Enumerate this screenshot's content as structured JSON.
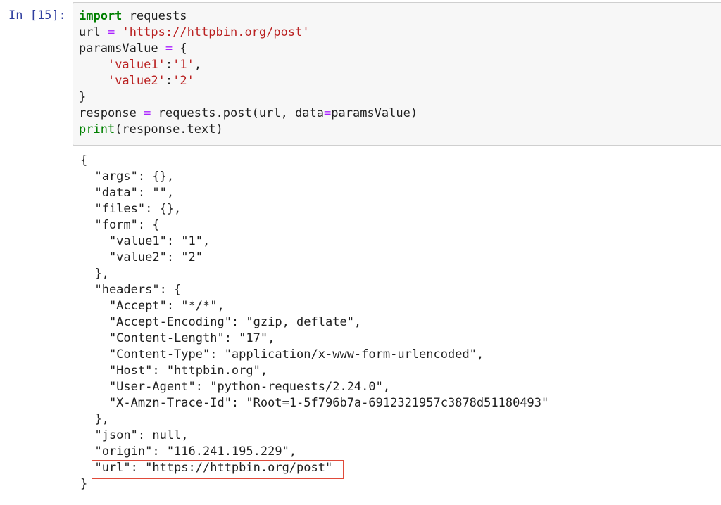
{
  "cell": {
    "prompt": "In [15]:",
    "code_lines": [
      [
        {
          "t": "import",
          "c": "kw"
        },
        {
          "t": " requests",
          "c": ""
        }
      ],
      [
        {
          "t": "url ",
          "c": ""
        },
        {
          "t": "=",
          "c": "op"
        },
        {
          "t": " ",
          "c": ""
        },
        {
          "t": "'https://httpbin.org/post'",
          "c": "str"
        }
      ],
      [
        {
          "t": "paramsValue ",
          "c": ""
        },
        {
          "t": "=",
          "c": "op"
        },
        {
          "t": " {",
          "c": ""
        }
      ],
      [
        {
          "t": "    ",
          "c": ""
        },
        {
          "t": "'value1'",
          "c": "str"
        },
        {
          "t": ":",
          "c": ""
        },
        {
          "t": "'1'",
          "c": "str"
        },
        {
          "t": ",",
          "c": ""
        }
      ],
      [
        {
          "t": "    ",
          "c": ""
        },
        {
          "t": "'value2'",
          "c": "str"
        },
        {
          "t": ":",
          "c": ""
        },
        {
          "t": "'2'",
          "c": "str"
        }
      ],
      [
        {
          "t": "}",
          "c": ""
        }
      ],
      [
        {
          "t": "response ",
          "c": ""
        },
        {
          "t": "=",
          "c": "op"
        },
        {
          "t": " requests.post(url, data",
          "c": ""
        },
        {
          "t": "=",
          "c": "op"
        },
        {
          "t": "paramsValue)",
          "c": ""
        }
      ],
      [
        {
          "t": "print",
          "c": "bi"
        },
        {
          "t": "(response.text)",
          "c": ""
        }
      ]
    ]
  },
  "output": {
    "lines": [
      "{",
      "  \"args\": {},",
      "  \"data\": \"\",",
      "  \"files\": {},",
      "  \"form\": {",
      "    \"value1\": \"1\",",
      "    \"value2\": \"2\"",
      "  },",
      "  \"headers\": {",
      "    \"Accept\": \"*/*\",",
      "    \"Accept-Encoding\": \"gzip, deflate\",",
      "    \"Content-Length\": \"17\",",
      "    \"Content-Type\": \"application/x-www-form-urlencoded\",",
      "    \"Host\": \"httpbin.org\",",
      "    \"User-Agent\": \"python-requests/2.24.0\",",
      "    \"X-Amzn-Trace-Id\": \"Root=1-5f796b7a-6912321957c3878d51180493\"",
      "  },",
      "  \"json\": null,",
      "  \"origin\": \"116.241.195.229\",",
      "  \"url\": \"https://httpbin.org/post\"",
      "}"
    ]
  },
  "colors": {
    "prompt": "#303f9f",
    "keyword": "#008000",
    "string": "#ba2121",
    "operator": "#aa22ff",
    "highlight_box": "#e04a3a",
    "cell_background": "#f7f7f7"
  }
}
